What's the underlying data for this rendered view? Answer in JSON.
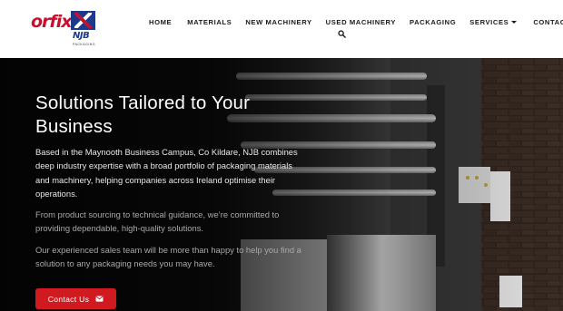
{
  "brand": {
    "logo_main": "orfix",
    "logo_sub": "NJB",
    "logo_tag": "PACKAGING"
  },
  "nav": {
    "items": [
      {
        "label": "HOME"
      },
      {
        "label": "MATERIALS"
      },
      {
        "label": "NEW MACHINERY"
      },
      {
        "label": "USED MACHINERY"
      },
      {
        "label": "PACKAGING"
      },
      {
        "label": "SERVICES",
        "has_dropdown": true
      },
      {
        "label": "CONTACT"
      }
    ],
    "search_icon": "search-icon"
  },
  "hero": {
    "title": "Solutions Tailored to Your Business",
    "paragraph_1": "Based in the Maynooth Business Campus, Co Kildare, NJB combines deep industry expertise with a broad portfolio of packaging materials and machinery, helping companies across Ireland optimise their operations.",
    "paragraph_2": "From product sourcing to technical guidance, we’re committed to providing dependable, high-quality solutions.",
    "paragraph_3": "Our experienced sales team will be more than happy to help you find a solution to any packaging needs you may have.",
    "cta_label": "Contact Us",
    "cta_icon": "envelope-icon"
  },
  "colors": {
    "brand_red": "#d11a1f",
    "brand_blue": "#1d3a8a",
    "hero_dark": "#121212"
  }
}
